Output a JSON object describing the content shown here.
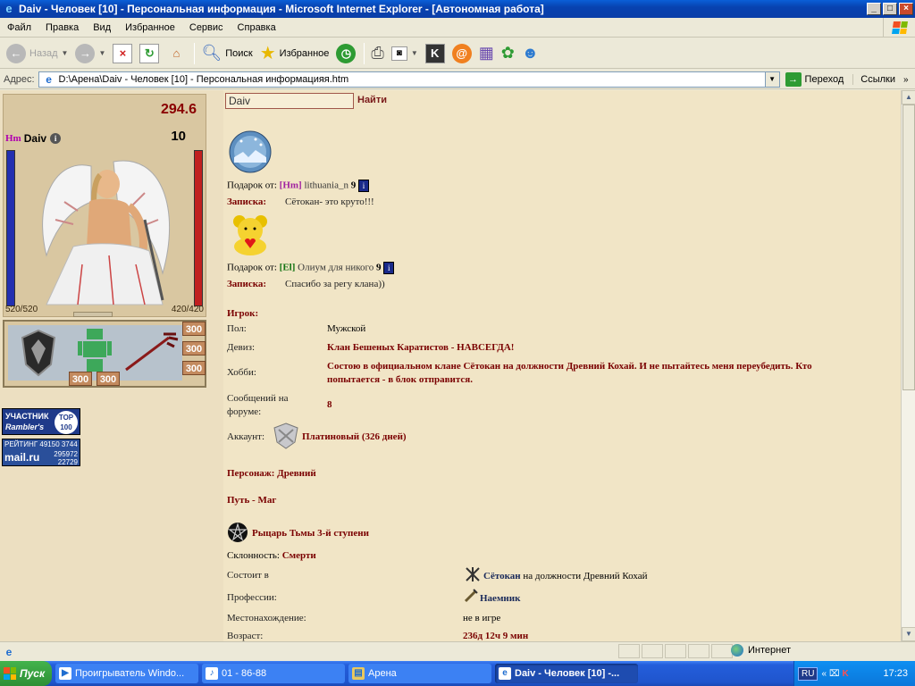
{
  "window": {
    "title": "Daiv - Человек [10] - Персональная информация - Microsoft Internet Explorer - [Автономная работа]",
    "controls": [
      "_",
      "□",
      "×"
    ]
  },
  "menu": [
    "Файл",
    "Правка",
    "Вид",
    "Избранное",
    "Сервис",
    "Справка"
  ],
  "toolbar": {
    "back_label": "Назад",
    "search_label": "Поиск",
    "favorites_label": "Избранное"
  },
  "address": {
    "label": "Адрес:",
    "url": "D:\\Арена\\Daiv - Человек [10] - Персональная информацияя.htm",
    "go_label": "Переход",
    "links_label": "Ссылки"
  },
  "character": {
    "hp_value": "294.6",
    "level": "10",
    "clan_tag": "Hm",
    "name": "Daiv",
    "hp_left": "520/520",
    "hp_right": "420/420",
    "slot_values": [
      "300",
      "300",
      "300",
      "300",
      "300"
    ]
  },
  "banners": {
    "rambler_line1": "УЧАСТНИК",
    "rambler_line2": "Rambler's",
    "rambler_top": "TOP 100",
    "mail_rating": "РЕЙТИНГ 49150 3744",
    "mail_logo": "mail.ru",
    "mail_n1": "295972",
    "mail_n2": "22729"
  },
  "search": {
    "value": "Daiv",
    "button": "Найти"
  },
  "gifts": [
    {
      "from_label": "Подарок от:",
      "tag": "[Hm]",
      "nick": "lithuania_n",
      "level": "9",
      "note_label": "Записка:",
      "note": "Сётокан- это круто!!!"
    },
    {
      "from_label": "Подарок от:",
      "tag": "[El]",
      "nick": "Олиум для никого",
      "level": "9",
      "note_label": "Записка:",
      "note": "Спасибо за регу клана))"
    }
  ],
  "player": {
    "heading": "Игрок:",
    "gender_label": "Пол:",
    "gender": "Мужской",
    "motto_label": "Девиз:",
    "motto": "Клан Бешеных Каратистов - НАВСЕГДА!",
    "hobby_label": "Хобби:",
    "hobby_line1": "Состою в официальном клане Сётокан на должности Древний Кохай. И не пытайтесь меня переубедить. Кто",
    "hobby_line2": "попытается - в блок отправится.",
    "posts_label_1": "Сообщений на",
    "posts_label_2": "форуме:",
    "posts": "8",
    "account_label": "Аккаунт:",
    "account": "Платиновый (326 дней)",
    "persona": "Персонаж: Древний",
    "path": "Путь - Маг",
    "rank": "Рыцарь Тьмы 3-й ступени",
    "alignment_label": "Склонность:",
    "alignment": "Смерти",
    "member_label": "Состоит в",
    "clan": "Сётокан",
    "clan_post": " на должности Древний Кохай",
    "profession_label": "Профессии:",
    "profession": "Наемник",
    "location_label": "Местонахождение:",
    "location": "не в игре",
    "age_label": "Возраст:",
    "age": "236д 12ч 9 мин"
  },
  "status": {
    "zone": "Интернет"
  },
  "taskbar": {
    "start": "Пуск",
    "tasks": [
      "Проигрыватель Windo...",
      "01 - 86-88",
      "Арена",
      "Daiv - Человек [10] -..."
    ],
    "lang": "RU",
    "clock": "17:23"
  }
}
